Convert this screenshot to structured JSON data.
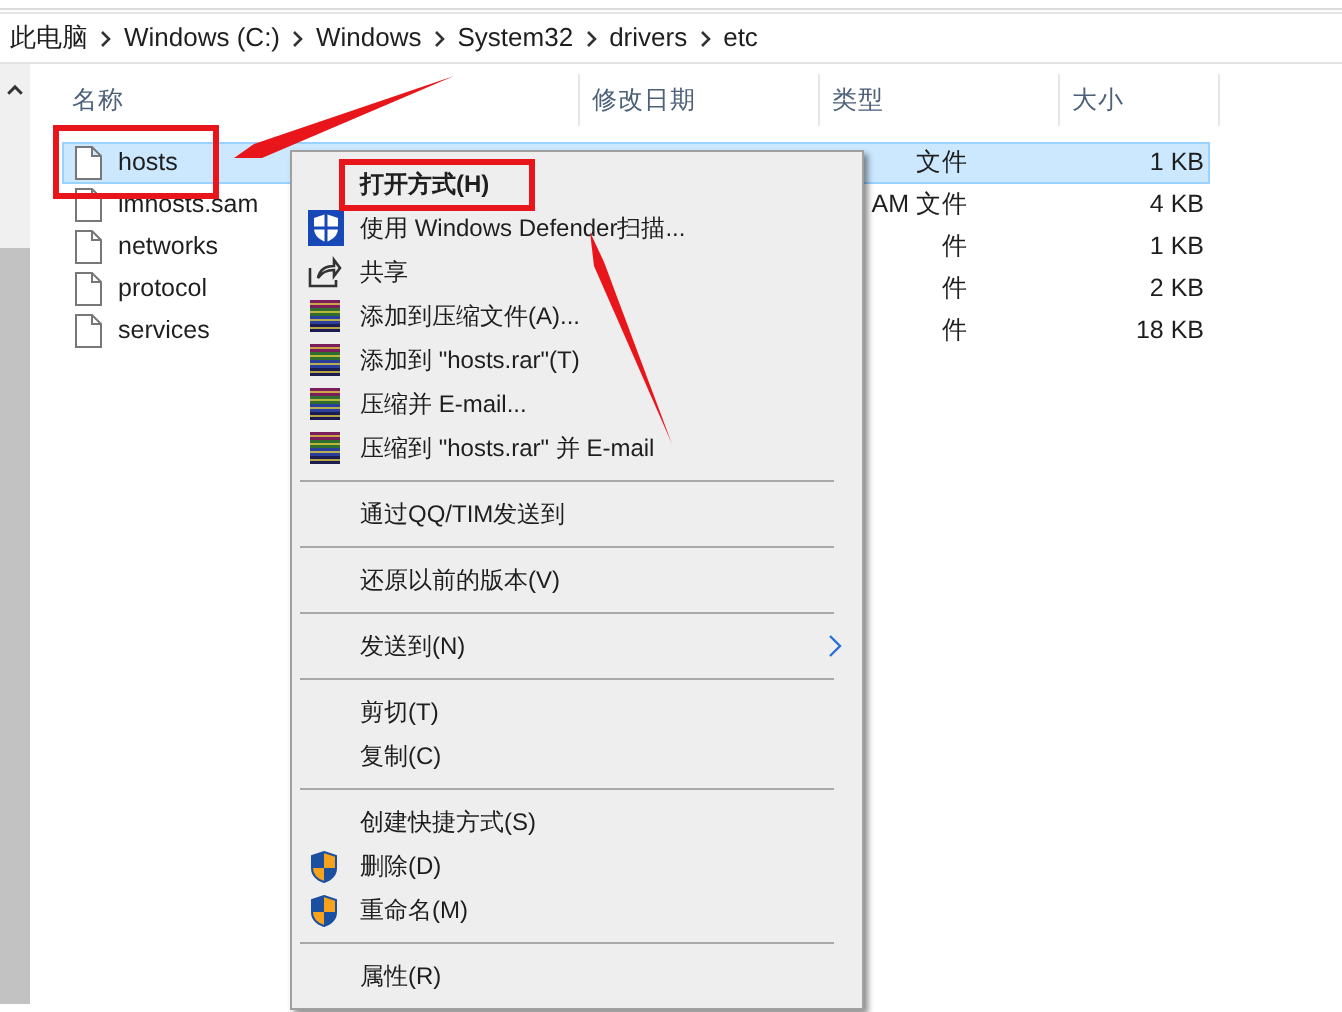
{
  "breadcrumb": [
    "此电脑",
    "Windows (C:)",
    "Windows",
    "System32",
    "drivers",
    "etc"
  ],
  "columns": [
    "名称",
    "修改日期",
    "类型",
    "大小"
  ],
  "files": [
    {
      "name": "hosts",
      "type": "文件",
      "size": "1 KB",
      "selected": true
    },
    {
      "name": "lmhosts.sam",
      "type": "AM 文件",
      "size": "4 KB",
      "selected": false
    },
    {
      "name": "networks",
      "type": "件",
      "size": "1 KB",
      "selected": false
    },
    {
      "name": "protocol",
      "type": "件",
      "size": "2 KB",
      "selected": false
    },
    {
      "name": "services",
      "type": "件",
      "size": "18 KB",
      "selected": false
    }
  ],
  "context_menu": [
    {
      "kind": "plain",
      "label": "打开方式(H)",
      "bold": true
    },
    {
      "kind": "defender",
      "label": "使用 Windows Defender扫描..."
    },
    {
      "kind": "share",
      "label": "共享"
    },
    {
      "kind": "archive",
      "label": "添加到压缩文件(A)..."
    },
    {
      "kind": "archive",
      "label": "添加到 \"hosts.rar\"(T)"
    },
    {
      "kind": "archive",
      "label": "压缩并 E-mail..."
    },
    {
      "kind": "archive",
      "label": "压缩到 \"hosts.rar\" 并 E-mail"
    },
    {
      "kind": "separator"
    },
    {
      "kind": "plain",
      "label": "通过QQ/TIM发送到"
    },
    {
      "kind": "separator"
    },
    {
      "kind": "plain",
      "label": "还原以前的版本(V)"
    },
    {
      "kind": "separator"
    },
    {
      "kind": "plain",
      "label": "发送到(N)",
      "submenu": true
    },
    {
      "kind": "separator"
    },
    {
      "kind": "plain",
      "label": "剪切(T)"
    },
    {
      "kind": "plain",
      "label": "复制(C)"
    },
    {
      "kind": "separator"
    },
    {
      "kind": "plain",
      "label": "创建快捷方式(S)"
    },
    {
      "kind": "admin",
      "label": "删除(D)"
    },
    {
      "kind": "admin",
      "label": "重命名(M)"
    },
    {
      "kind": "separator"
    },
    {
      "kind": "plain",
      "label": "属性(R)"
    }
  ]
}
